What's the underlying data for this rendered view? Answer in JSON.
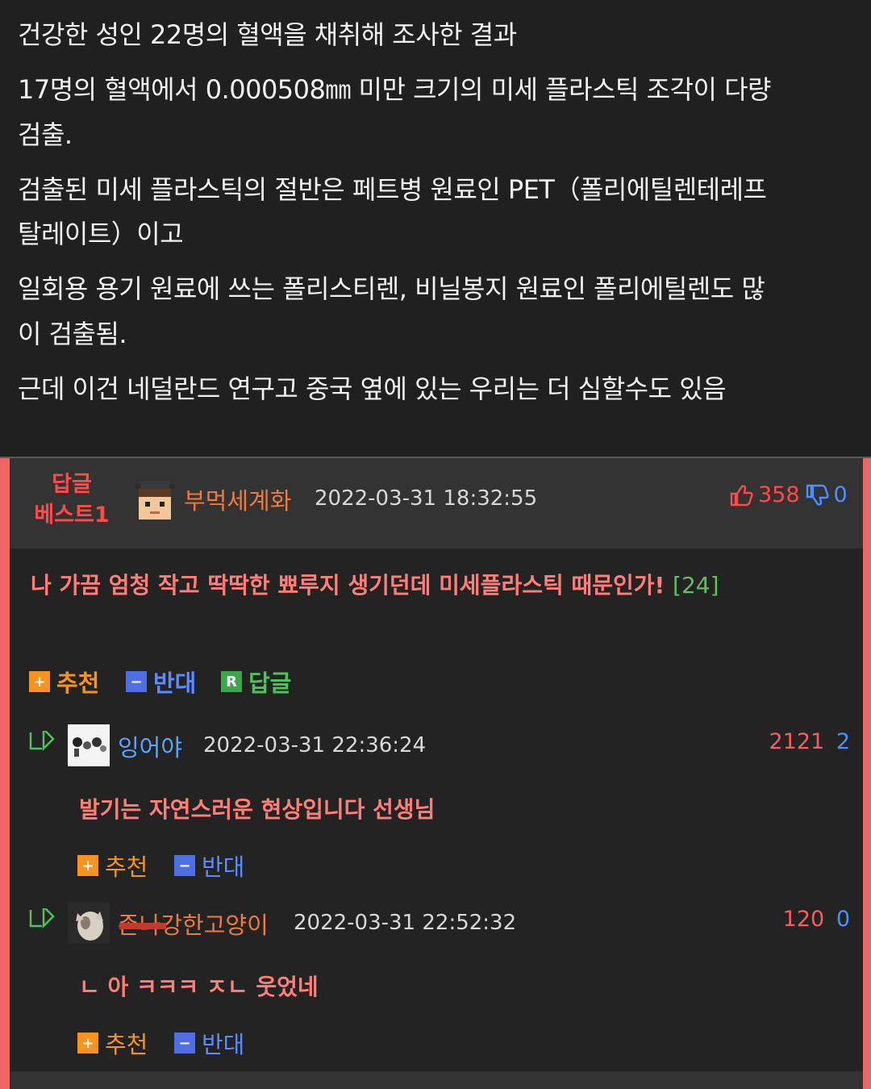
{
  "article": {
    "lines": [
      "건강한 성인 22명의 혈액을 채취해 조사한 결과",
      "17명의 혈액에서 0.000508㎜ 미만 크기의 미세 플라스틱 조각이 다량",
      "검출.",
      "검출된 미세 플라스틱의 절반은 페트병 원료인 PET（폴리에틸렌테레프",
      "탈레이트）이고",
      "일회용 용기 원료에 쓰는 폴리스티렌, 비닐봉지 원료인 폴리에틸렌도 많",
      "이 검출됨.",
      "근데 이건 네덜란드 연구고 중국 옆에 있는 우리는 더 심할수도 있음"
    ]
  },
  "best_comment": {
    "label_line1": "답글",
    "label_line2": "베스트1",
    "username": "부먹세계화",
    "date": "2022-03-31 18:32:55",
    "upvotes": "358",
    "downvotes": "0",
    "text": "나 가끔 엄청 작고 딱딱한 뾰루지 생기던데 미세플라스틱 때문인가!",
    "reply_count": "[24]",
    "buttons": {
      "recommend": "추천",
      "oppose": "반대",
      "reply": "답글"
    },
    "button_icons": {
      "recommend": "+",
      "oppose": "−",
      "reply": "R"
    }
  },
  "replies": [
    {
      "username": "잉어야",
      "date": "2022-03-31 22:36:24",
      "upvotes": "2121",
      "downvotes": "2",
      "text": "발기는 자연스러운 현상입니다 선생님",
      "buttons": {
        "recommend": "추천",
        "oppose": "반대"
      }
    },
    {
      "username": "존나강한고양이",
      "date": "2022-03-31 22:52:32",
      "upvotes": "120",
      "downvotes": "0",
      "text": "ㄴ 아 ㅋㅋㅋ ㅈㄴ 웃었네",
      "buttons": {
        "recommend": "추천",
        "oppose": "반대"
      }
    }
  ],
  "colors": {
    "accent_red": "#ff4a4a",
    "comment_text": "#ff7f78",
    "username_orange": "#f07a3c",
    "username_blue": "#5aa6ff",
    "reply_green": "#5cc25a",
    "down_blue": "#4d8fff",
    "frame_red": "#f26565"
  }
}
